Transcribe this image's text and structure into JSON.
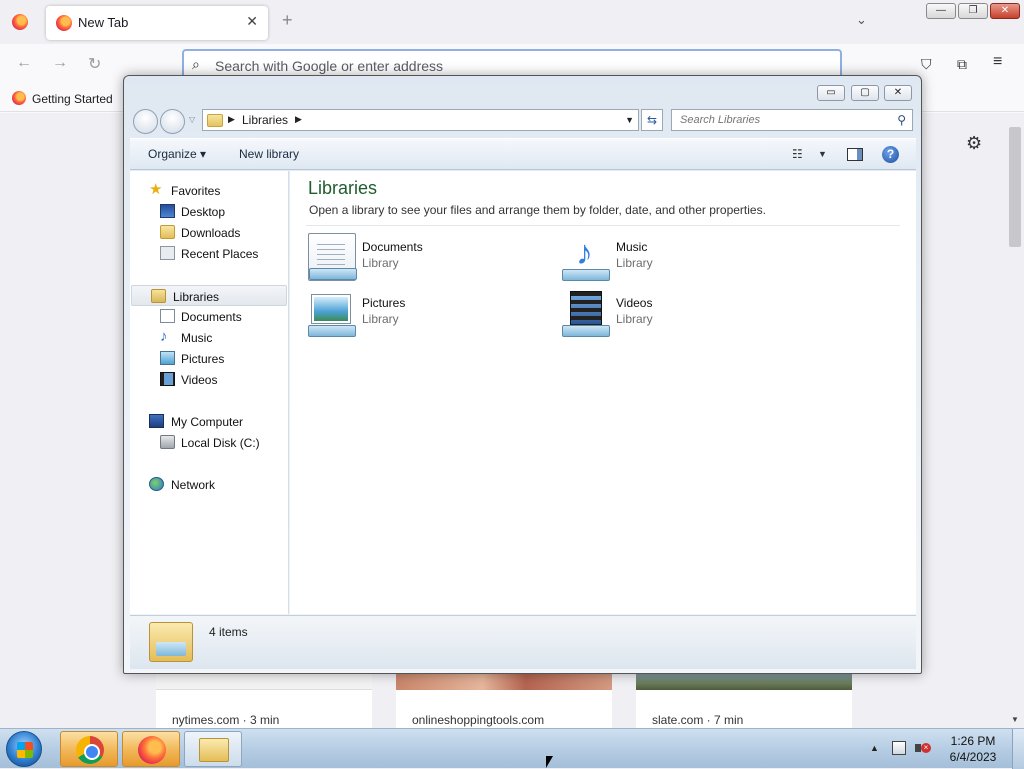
{
  "browser": {
    "tab_title": "New Tab",
    "tab_close_glyph": "✕",
    "new_tab_glyph": "+",
    "tab_list_glyph": "⌄",
    "caption": {
      "minimize": "—",
      "maximize": "❐",
      "close": "✕"
    },
    "nav": {
      "back_glyph": "←",
      "forward_glyph": "→",
      "reload_glyph": "↻"
    },
    "url_placeholder": "Search with Google or enter address",
    "search_glyph": "⌕",
    "toolbar": {
      "pocket_glyph": "⛉",
      "extensions_glyph": "⧉",
      "menu_glyph": "≡"
    },
    "bookmark_label": "Getting Started",
    "settings_glyph": "⚙",
    "stories": [
      {
        "source": "nytimes.com · 3 min"
      },
      {
        "source": "onlineshoppingtools.com"
      },
      {
        "source": "slate.com · 7 min"
      }
    ]
  },
  "explorer": {
    "caption": {
      "minimize": "▭",
      "maximize": "▢",
      "close": "✕"
    },
    "address": {
      "crumb": "Libraries",
      "arrow": "▶",
      "dropdown": "▼"
    },
    "refresh_glyph": "⇆",
    "search_placeholder": "Search Libraries",
    "search_glyph": "⚲",
    "toolbar": {
      "organize": "Organize ▾",
      "new_library": "New library",
      "views_glyph": "☷",
      "views_dropdown": "▼",
      "help": "?"
    },
    "nav": {
      "favorites": "Favorites",
      "desktop": "Desktop",
      "downloads": "Downloads",
      "recent_places": "Recent Places",
      "libraries": "Libraries",
      "documents": "Documents",
      "music": "Music",
      "pictures": "Pictures",
      "videos": "Videos",
      "my_computer": "My Computer",
      "local_disk": "Local Disk (C:)",
      "network": "Network"
    },
    "content": {
      "title": "Libraries",
      "description": "Open a library to see your files and arrange them by folder, date, and other properties.",
      "libraries": [
        {
          "name": "Documents",
          "type": "Library"
        },
        {
          "name": "Music",
          "type": "Library"
        },
        {
          "name": "Pictures",
          "type": "Library"
        },
        {
          "name": "Videos",
          "type": "Library"
        }
      ]
    },
    "status": "4 items"
  },
  "taskbar": {
    "time": "1:26 PM",
    "date": "6/4/2023",
    "tray_arrow": "▲",
    "mute_glyph": "×"
  }
}
